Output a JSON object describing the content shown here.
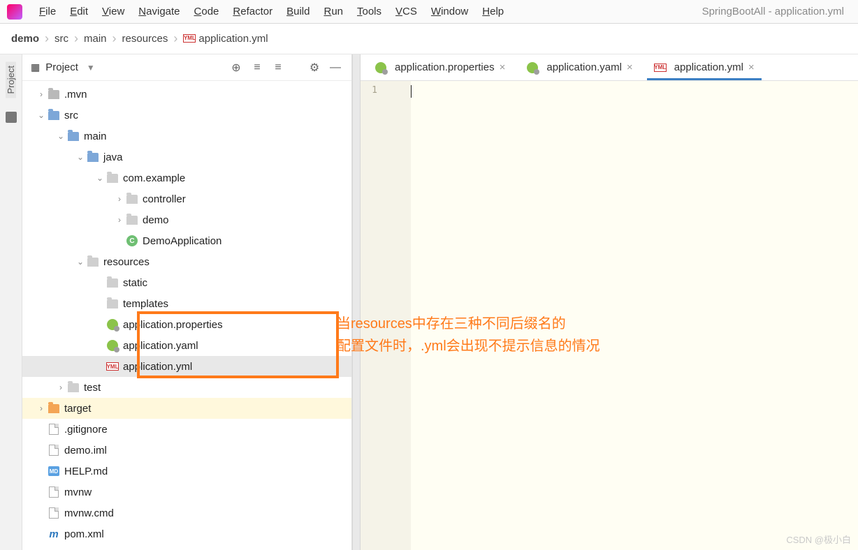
{
  "window_title": "SpringBootAll - application.yml",
  "menu": [
    "File",
    "Edit",
    "View",
    "Navigate",
    "Code",
    "Refactor",
    "Build",
    "Run",
    "Tools",
    "VCS",
    "Window",
    "Help"
  ],
  "breadcrumb": [
    "demo",
    "src",
    "main",
    "resources",
    "application.yml"
  ],
  "project_pane": {
    "title": "Project"
  },
  "tree": [
    {
      "indent": 0,
      "arrow": "right",
      "icon": "folder",
      "label": ".mvn"
    },
    {
      "indent": 0,
      "arrow": "down",
      "icon": "folder-blue",
      "label": "src"
    },
    {
      "indent": 1,
      "arrow": "down",
      "icon": "folder-blue",
      "label": "main"
    },
    {
      "indent": 2,
      "arrow": "down",
      "icon": "folder-blue",
      "label": "java"
    },
    {
      "indent": 3,
      "arrow": "down",
      "icon": "folder-dim",
      "label": "com.example"
    },
    {
      "indent": 4,
      "arrow": "right",
      "icon": "folder-dim",
      "label": "controller"
    },
    {
      "indent": 4,
      "arrow": "right",
      "icon": "folder-dim",
      "label": "demo"
    },
    {
      "indent": 4,
      "arrow": "",
      "icon": "class",
      "label": "DemoApplication"
    },
    {
      "indent": 2,
      "arrow": "down",
      "icon": "folder-dim",
      "label": "resources"
    },
    {
      "indent": 3,
      "arrow": "",
      "icon": "folder-dim",
      "label": "static"
    },
    {
      "indent": 3,
      "arrow": "",
      "icon": "folder-dim",
      "label": "templates"
    },
    {
      "indent": 3,
      "arrow": "",
      "icon": "green",
      "label": "application.properties"
    },
    {
      "indent": 3,
      "arrow": "",
      "icon": "green",
      "label": "application.yaml"
    },
    {
      "indent": 3,
      "arrow": "",
      "icon": "yml",
      "label": "application.yml",
      "row": "cur"
    },
    {
      "indent": 1,
      "arrow": "right",
      "icon": "folder-dim",
      "label": "test"
    },
    {
      "indent": 0,
      "arrow": "right",
      "icon": "folder-orange",
      "label": "target",
      "row": "sel"
    },
    {
      "indent": 0,
      "arrow": "",
      "icon": "file",
      "label": ".gitignore"
    },
    {
      "indent": 0,
      "arrow": "",
      "icon": "file",
      "label": "demo.iml"
    },
    {
      "indent": 0,
      "arrow": "",
      "icon": "md",
      "label": "HELP.md"
    },
    {
      "indent": 0,
      "arrow": "",
      "icon": "file",
      "label": "mvnw"
    },
    {
      "indent": 0,
      "arrow": "",
      "icon": "file",
      "label": "mvnw.cmd"
    },
    {
      "indent": 0,
      "arrow": "",
      "icon": "m",
      "label": "pom.xml"
    }
  ],
  "tabs": [
    {
      "icon": "green",
      "label": "application.properties",
      "active": false
    },
    {
      "icon": "green",
      "label": "application.yaml",
      "active": false
    },
    {
      "icon": "yml",
      "label": "application.yml",
      "active": true
    }
  ],
  "gutter_line": "1",
  "annotation_line1": "当resources中存在三种不同后缀名的",
  "annotation_line2": "配置文件时，.yml会出现不提示信息的情况",
  "watermark": "CSDN @极小白"
}
